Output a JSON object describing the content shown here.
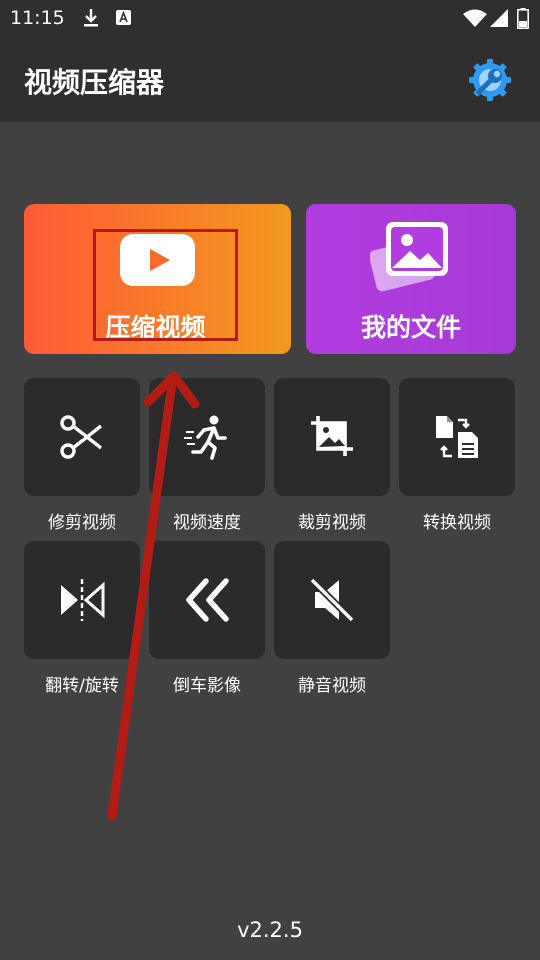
{
  "status_bar": {
    "time": "11:15"
  },
  "app_bar": {
    "title": "视频压缩器",
    "settings_icon": "gear-wrench-icon"
  },
  "primary_actions": {
    "compress": {
      "label": "压缩视频",
      "icon": "play-icon"
    },
    "my_files": {
      "label": "我的文件",
      "icon": "image-stack-icon"
    }
  },
  "tools": [
    {
      "label": "修剪视频",
      "icon": "scissors-icon"
    },
    {
      "label": "视频速度",
      "icon": "running-icon"
    },
    {
      "label": "裁剪视频",
      "icon": "crop-icon"
    },
    {
      "label": "转换视频",
      "icon": "convert-icon"
    },
    {
      "label": "翻转/旋转",
      "icon": "flip-icon"
    },
    {
      "label": "倒车影像",
      "icon": "rewind-icon"
    },
    {
      "label": "静音视频",
      "icon": "mute-icon"
    }
  ],
  "version": "v2.2.5",
  "colors": {
    "background": "#414141",
    "bar": "#2f2f2f",
    "tile": "#2b2b2b",
    "compress_gradient_start": "#ff5a36",
    "compress_gradient_end": "#f29a1e",
    "files_gradient_start": "#b13de0",
    "files_gradient_end": "#a63ad6",
    "annotation_red": "#b31c14"
  }
}
